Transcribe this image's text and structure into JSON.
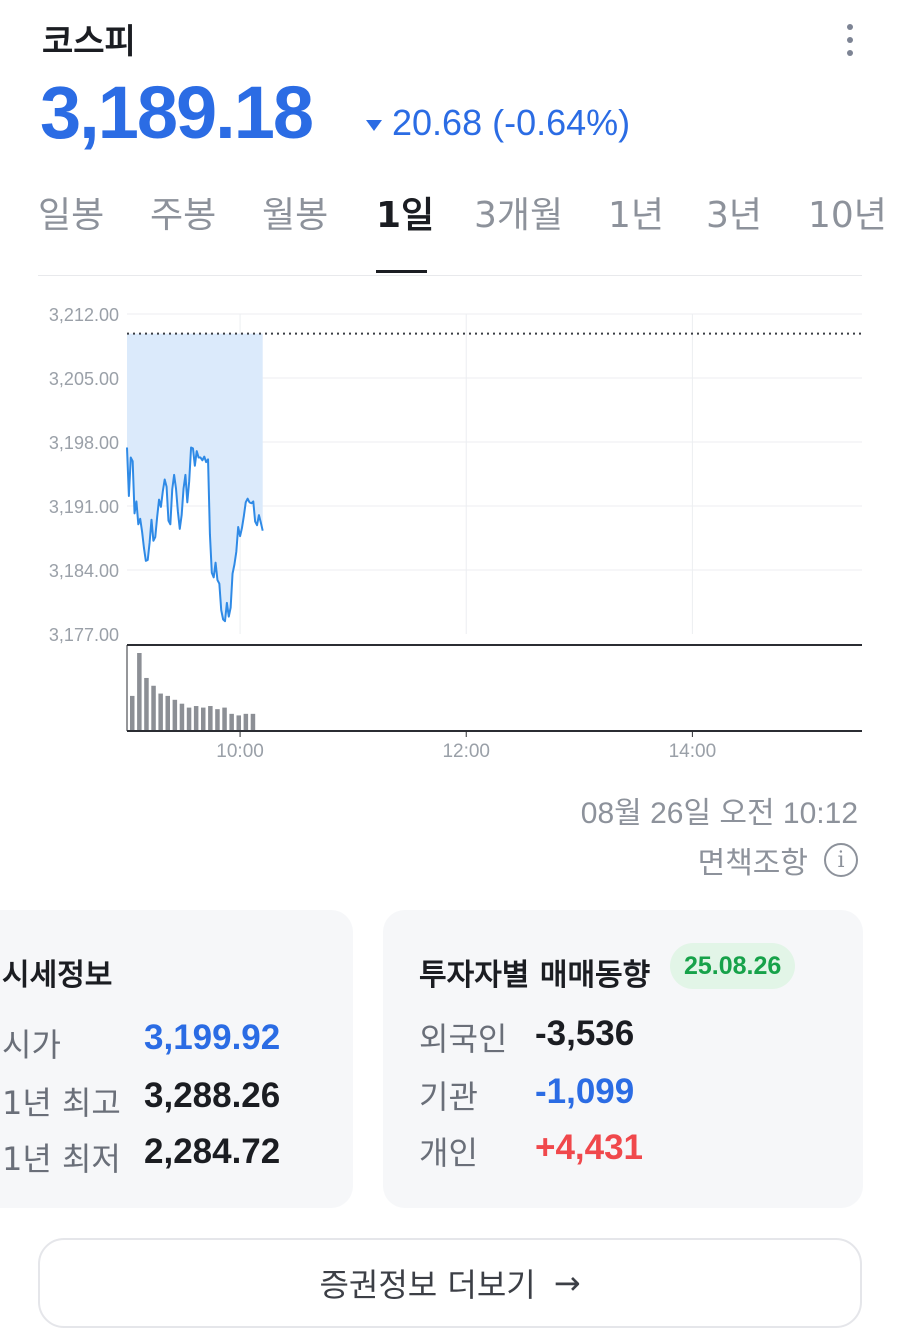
{
  "header": {
    "title": "코스피",
    "price": "3,189.18",
    "change": "20.68 (-0.64%)",
    "change_direction": "down",
    "menu_icon": "more-vertical-icon"
  },
  "tabs": [
    {
      "label": "일봉",
      "active": false
    },
    {
      "label": "주봉",
      "active": false
    },
    {
      "label": "월봉",
      "active": false
    },
    {
      "label": "1일",
      "active": true
    },
    {
      "label": "3개월",
      "active": false
    },
    {
      "label": "1년",
      "active": false
    },
    {
      "label": "3년",
      "active": false
    },
    {
      "label": "10년",
      "active": false
    }
  ],
  "chart_data": {
    "type": "line",
    "y_ticks": [
      "3,212.00",
      "3,205.00",
      "3,198.00",
      "3,191.00",
      "3,184.00",
      "3,177.00"
    ],
    "x_ticks": [
      "10:00",
      "12:00",
      "14:00"
    ],
    "ylim": [
      3177,
      3212
    ],
    "reference_value": 3209.86,
    "series": [
      {
        "x": [
          "09:00",
          "09:01",
          "09:02",
          "09:03",
          "09:04",
          "09:05",
          "09:06",
          "09:07",
          "09:08",
          "09:09",
          "09:10",
          "09:11",
          "09:12",
          "09:13",
          "09:14",
          "09:15",
          "09:16",
          "09:17",
          "09:18",
          "09:19",
          "09:20",
          "09:21",
          "09:22",
          "09:23",
          "09:24",
          "09:25",
          "09:26",
          "09:27",
          "09:28",
          "09:29",
          "09:30",
          "09:31",
          "09:32",
          "09:33",
          "09:34",
          "09:35",
          "09:36",
          "09:37",
          "09:38",
          "09:39",
          "09:40",
          "09:41",
          "09:42",
          "09:43",
          "09:44",
          "09:45",
          "09:46",
          "09:47",
          "09:48",
          "09:49",
          "09:50",
          "09:51",
          "09:52",
          "09:53",
          "09:54",
          "09:55",
          "09:56",
          "09:57",
          "09:58",
          "09:59",
          "10:00",
          "10:01",
          "10:02",
          "10:03",
          "10:04",
          "10:05",
          "10:06",
          "10:07",
          "10:08",
          "10:09",
          "10:10",
          "10:11",
          "10:12"
        ],
        "values": [
          3197.4,
          3192.1,
          3196.3,
          3195.9,
          3190.2,
          3191.5,
          3189.0,
          3189.6,
          3188.2,
          3186.4,
          3185.0,
          3185.1,
          3187.0,
          3189.5,
          3187.2,
          3187.6,
          3189.8,
          3191.7,
          3190.9,
          3192.6,
          3193.9,
          3193.1,
          3189.4,
          3189.0,
          3192.8,
          3194.4,
          3192.9,
          3190.4,
          3188.5,
          3190.0,
          3192.9,
          3194.4,
          3191.4,
          3193.7,
          3197.4,
          3197.3,
          3195.4,
          3197.0,
          3196.3,
          3196.3,
          3196.0,
          3196.4,
          3195.8,
          3196.1,
          3187.9,
          3183.7,
          3183.2,
          3184.8,
          3182.9,
          3182.5,
          3179.6,
          3178.6,
          3178.4,
          3180.4,
          3178.9,
          3179.9,
          3183.6,
          3184.6,
          3186.0,
          3188.7,
          3187.7,
          3188.6,
          3189.9,
          3191.4,
          3191.8,
          3191.4,
          3191.3,
          3191.5,
          3189.3,
          3188.9,
          3190.0,
          3189.2,
          3188.3
        ]
      }
    ],
    "volume_values": [
      45,
      100,
      68,
      58,
      48,
      45,
      40,
      35,
      30,
      32,
      30,
      32,
      28,
      30,
      22,
      20,
      22,
      22
    ]
  },
  "timestamp": "08월 26일 오전 10:12",
  "disclaimer": "면책조항",
  "price_info": {
    "title": "시세정보",
    "rows": [
      {
        "label": "시가",
        "value": "3,199.92"
      },
      {
        "label": "1년 최고",
        "value": "3,288.26"
      },
      {
        "label": "1년 최저",
        "value": "2,284.72"
      }
    ]
  },
  "investor": {
    "title": "투자자별 매매동향",
    "date": "25.08.26",
    "rows": [
      {
        "label": "외국인",
        "value": "-3,536"
      },
      {
        "label": "기관",
        "value": "-1,099"
      },
      {
        "label": "개인",
        "value": "+4,431"
      }
    ]
  },
  "more_button": "증권정보 더보기",
  "colors": {
    "accent_blue": "#2b6ce4",
    "line_blue": "#2f8ae6",
    "fill_blue": "#dbeafb",
    "up_red": "#f0484c",
    "green_badge_text": "#17a24a",
    "green_badge_bg": "#e2f5e7"
  }
}
